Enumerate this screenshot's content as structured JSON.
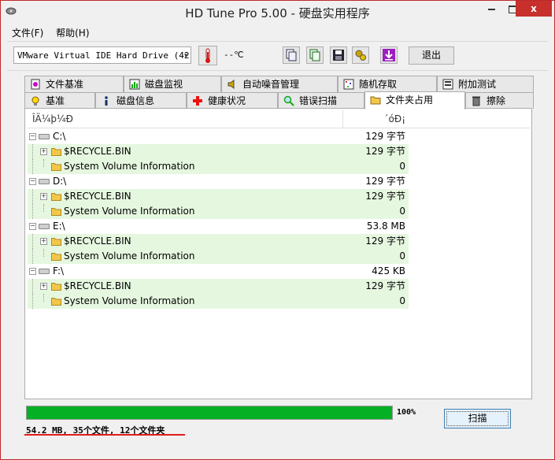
{
  "window": {
    "title": "HD Tune Pro 5.00 - 硬盘实用程序",
    "close_label": "x"
  },
  "menu": [
    {
      "label": "文件(F)"
    },
    {
      "label": "帮助(H)"
    }
  ],
  "toolbar": {
    "drive": "VMware Virtual IDE Hard Drive (42",
    "temperature": "--℃",
    "exit_label": "退出"
  },
  "tabs": {
    "row1": [
      {
        "label": "文件基准",
        "icon": "file-benchmark-icon"
      },
      {
        "label": "磁盘监视",
        "icon": "disk-monitor-icon"
      },
      {
        "label": "自动噪音管理",
        "icon": "speaker-icon"
      },
      {
        "label": "随机存取",
        "icon": "random-access-icon"
      },
      {
        "label": "附加测试",
        "icon": "extra-tests-icon"
      }
    ],
    "row2": [
      {
        "label": "基准",
        "icon": "lightbulb-icon"
      },
      {
        "label": "磁盘信息",
        "icon": "info-icon"
      },
      {
        "label": "健康状况",
        "icon": "health-cross-icon"
      },
      {
        "label": "错误扫描",
        "icon": "magnifier-icon"
      },
      {
        "label": "文件夹占用",
        "icon": "folder-icon",
        "active": true
      },
      {
        "label": "擦除",
        "icon": "trash-icon"
      }
    ]
  },
  "list": {
    "col_name": "ÎÄ¼þ¼Ð",
    "col_size": "´óÐ¡",
    "rows": [
      {
        "name": "C:\\",
        "size": "129 字节",
        "level": 0,
        "type": "drive"
      },
      {
        "name": "$RECYCLE.BIN",
        "size": "129 字节",
        "level": 1,
        "type": "folder",
        "expand": true
      },
      {
        "name": "System Volume Information",
        "size": "0",
        "level": 1,
        "type": "folder"
      },
      {
        "name": "D:\\",
        "size": "129 字节",
        "level": 0,
        "type": "drive"
      },
      {
        "name": "$RECYCLE.BIN",
        "size": "129 字节",
        "level": 1,
        "type": "folder",
        "expand": true
      },
      {
        "name": "System Volume Information",
        "size": "0",
        "level": 1,
        "type": "folder"
      },
      {
        "name": "E:\\",
        "size": "53.8 MB",
        "level": 0,
        "type": "drive"
      },
      {
        "name": "$RECYCLE.BIN",
        "size": "129 字节",
        "level": 1,
        "type": "folder",
        "expand": true
      },
      {
        "name": "System Volume Information",
        "size": "0",
        "level": 1,
        "type": "folder"
      },
      {
        "name": "F:\\",
        "size": "425 KB",
        "level": 0,
        "type": "drive"
      },
      {
        "name": "$RECYCLE.BIN",
        "size": "129 字节",
        "level": 1,
        "type": "folder",
        "expand": true
      },
      {
        "name": "System Volume Information",
        "size": "0",
        "level": 1,
        "type": "folder"
      }
    ]
  },
  "progress": {
    "percent": 100,
    "label": "100%"
  },
  "scan_label": "扫描",
  "summary": "54.2 MB, 35个文件, 12个文件夹",
  "colors": {
    "progress": "#06b025",
    "row_alt": "#e6f7e0",
    "close": "#c7302c"
  }
}
